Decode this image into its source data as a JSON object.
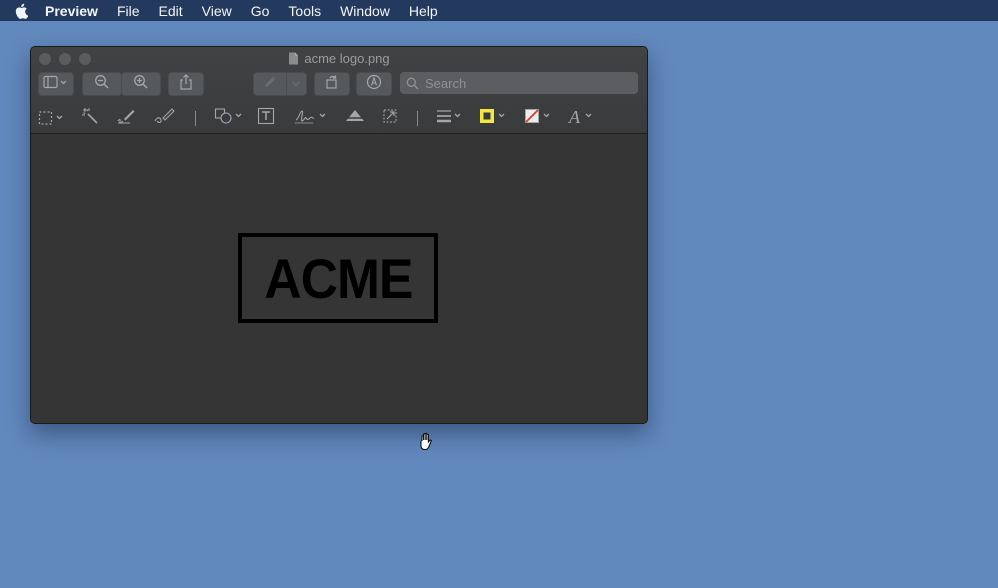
{
  "menubar": {
    "items": [
      "Preview",
      "File",
      "Edit",
      "View",
      "Go",
      "Tools",
      "Window",
      "Help"
    ]
  },
  "window": {
    "title": "acme logo.png",
    "search_placeholder": "Search"
  },
  "document": {
    "logo_text": "ACME"
  },
  "icons": {
    "toolbar": [
      "sidebar-icon",
      "zoom-out-icon",
      "zoom-in-icon",
      "share-icon",
      "pen-icon",
      "rotate-icon",
      "markup-icon",
      "search-icon"
    ],
    "markup": [
      "rect-selection-icon",
      "instant-alpha-icon",
      "sketch-icon",
      "draw-icon",
      "shapes-icon",
      "text-box-icon",
      "signature-icon",
      "adjust-color-icon",
      "adjust-size-icon",
      "line-style-icon",
      "border-color-icon",
      "fill-color-icon",
      "text-style-icon"
    ]
  },
  "colors": {
    "desktop": "#6289bd",
    "menubar": "#233a5e",
    "border_color_swatch": "#f5e642",
    "fill_color_swatch": "#d9342b"
  }
}
